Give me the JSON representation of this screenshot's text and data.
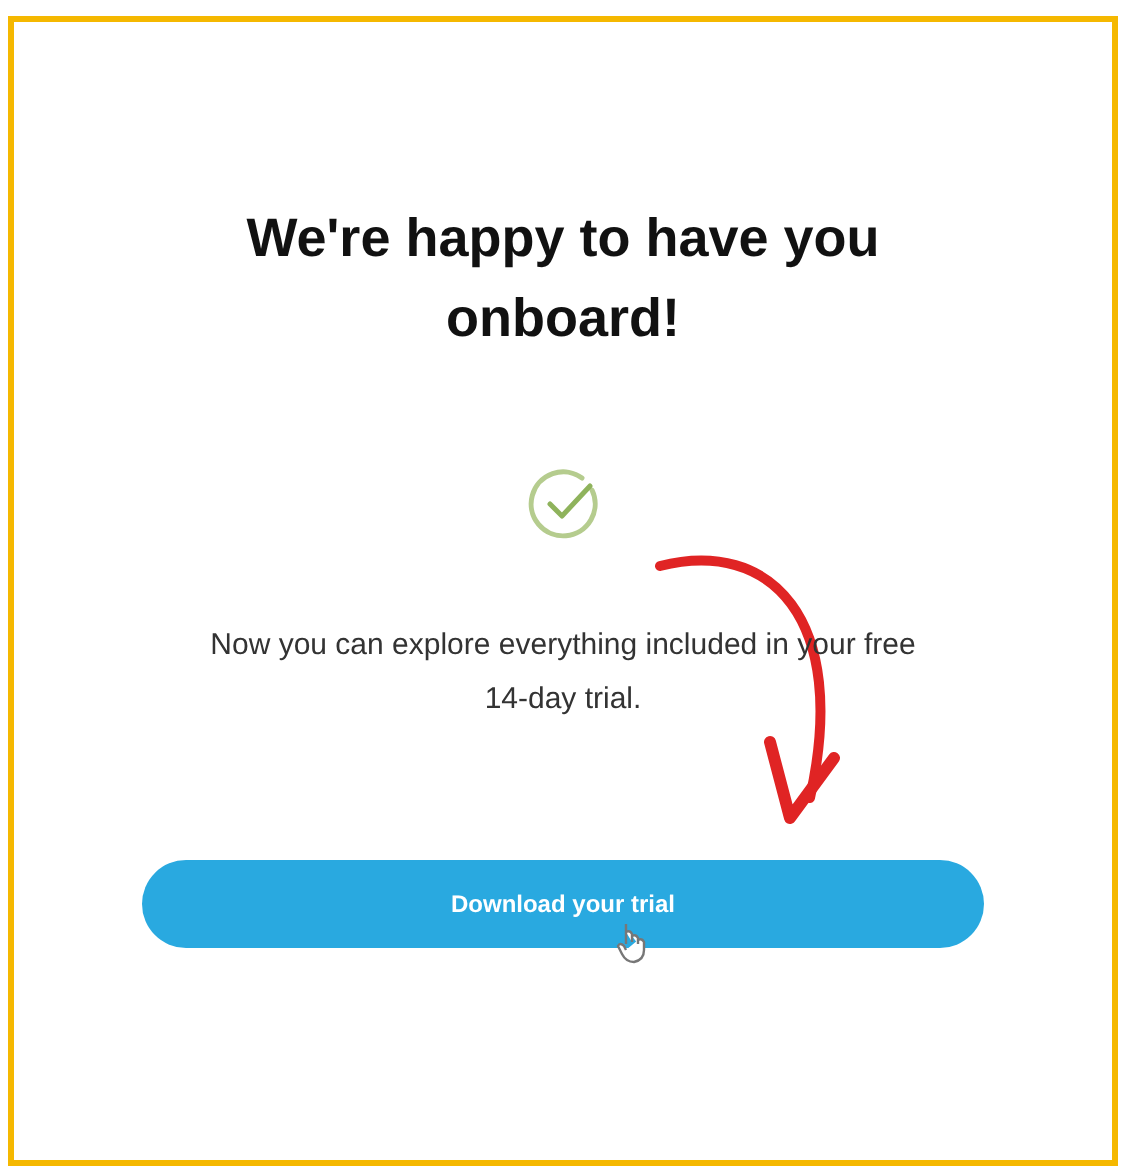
{
  "heading": "We're happy to have you onboard!",
  "message": "Now you can explore everything included in your free 14-day trial.",
  "button": {
    "label": "Download your trial"
  }
}
